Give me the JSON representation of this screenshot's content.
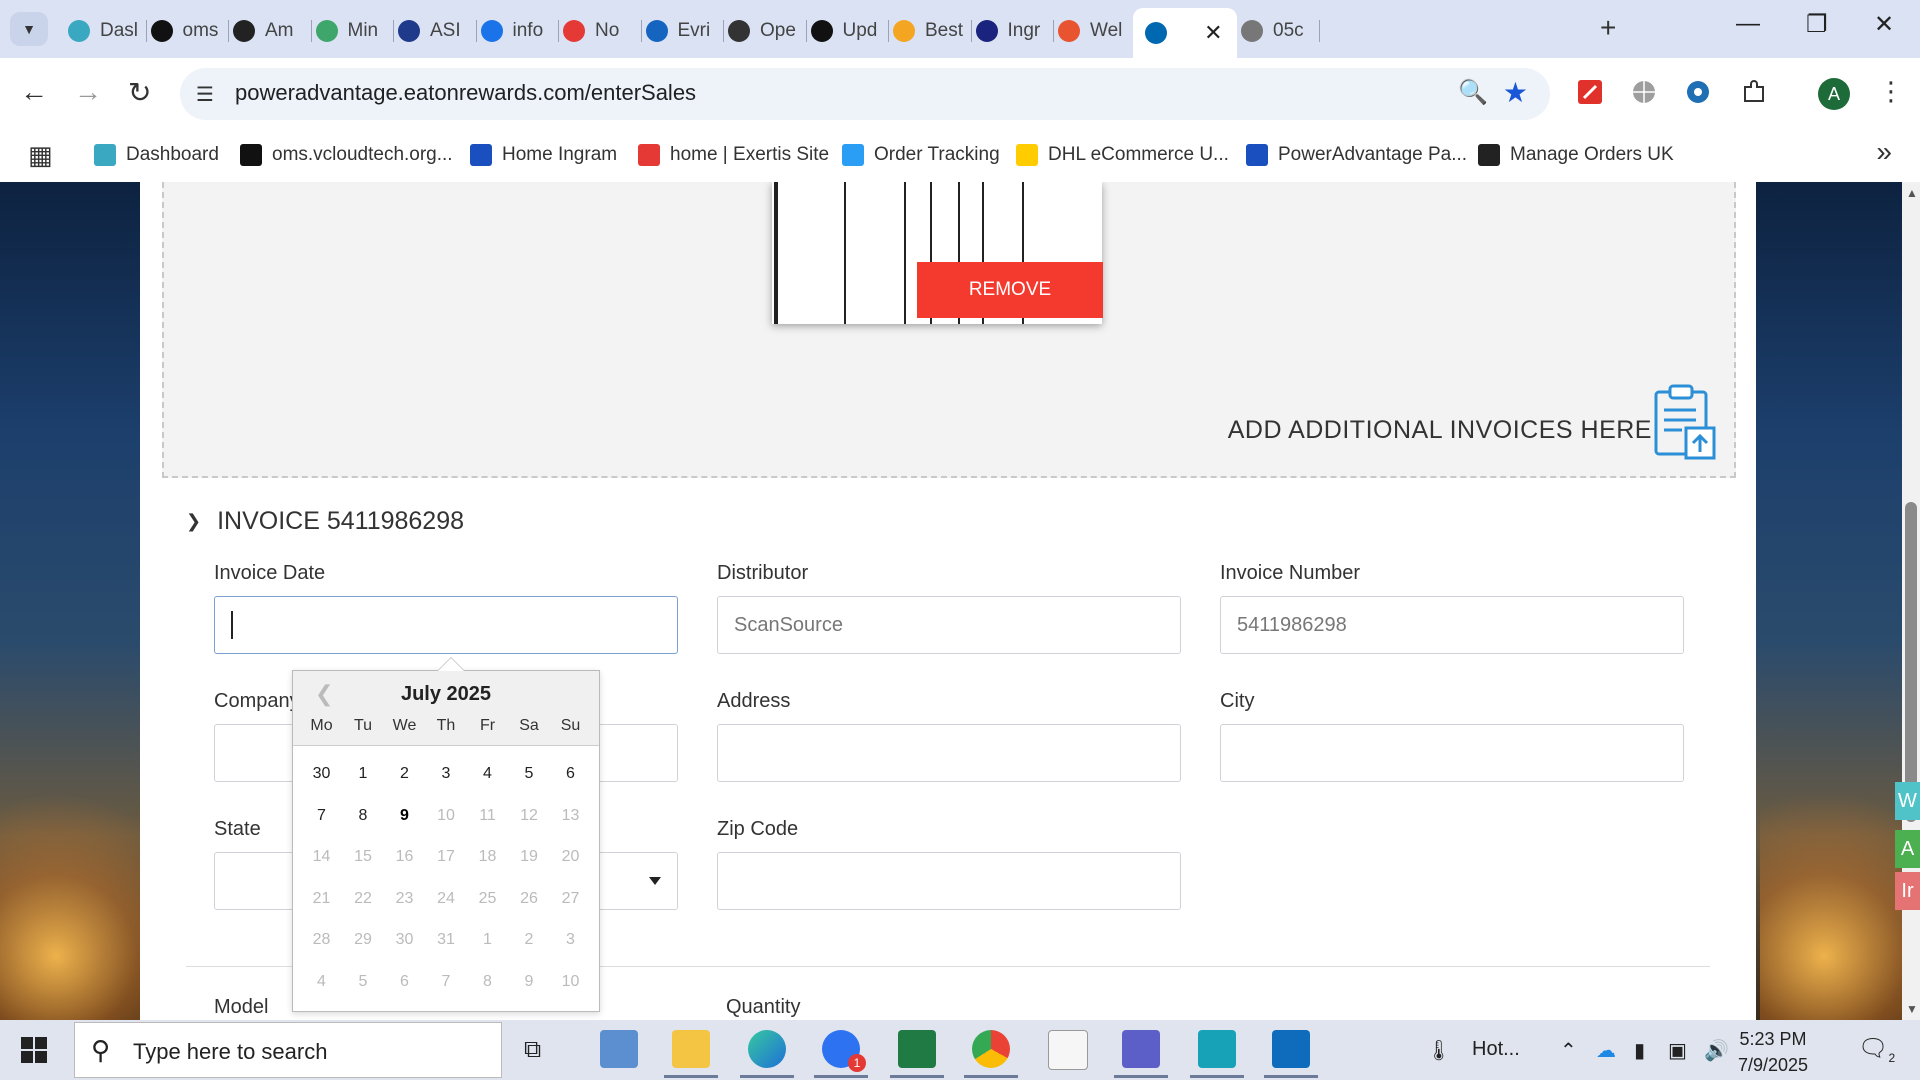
{
  "browser": {
    "tabs": [
      {
        "label": "Dasl",
        "icon": "hex-blue-icon",
        "color": "#3aa8c1"
      },
      {
        "label": "oms",
        "icon": "triangle-black-icon",
        "color": "#111111"
      },
      {
        "label": "Am",
        "icon": "amazon-icon",
        "color": "#222222"
      },
      {
        "label": "Min",
        "icon": "leaf-icon",
        "color": "#3fa66b"
      },
      {
        "label": "ASI",
        "icon": "play-arrow-icon",
        "color": "#1f3a8a"
      },
      {
        "label": "info",
        "icon": "swirl-icon",
        "color": "#1a73e8"
      },
      {
        "label": "No",
        "icon": "exertis-icon",
        "color": "#e53935"
      },
      {
        "label": "Evri",
        "icon": "evri-icon",
        "color": "#1565c0"
      },
      {
        "label": "Ope",
        "icon": "openai-icon",
        "color": "#333333"
      },
      {
        "label": "Upd",
        "icon": "openai-icon",
        "color": "#111111"
      },
      {
        "label": "Best",
        "icon": "bulb-icon",
        "color": "#f4a623"
      },
      {
        "label": "Ingr",
        "icon": "ingram-icon",
        "color": "#1a237e"
      },
      {
        "label": "Wel",
        "icon": "cube-icon",
        "color": "#e8542f"
      },
      {
        "label": "",
        "icon": "eaton-icon",
        "color": "#0067b1",
        "active": true
      },
      {
        "label": "05c",
        "icon": "globe-icon",
        "color": "#777777"
      }
    ],
    "url": "poweradvantage.eatonrewards.com/enterSales",
    "profile_initial": "A",
    "bookmarks": [
      {
        "label": "Dashboard",
        "icon": "hex-blue-icon",
        "color": "#3aa8c1"
      },
      {
        "label": "oms.vcloudtech.org...",
        "icon": "triangle-black-icon",
        "color": "#111111"
      },
      {
        "label": "Home Ingram",
        "icon": "im-icon",
        "color": "#1a4fc0"
      },
      {
        "label": "home | Exertis Site",
        "icon": "exertis-icon",
        "color": "#e53935"
      },
      {
        "label": "Order Tracking",
        "icon": "c-circle-icon",
        "color": "#2a9df4"
      },
      {
        "label": "DHL eCommerce U...",
        "icon": "dhl-icon",
        "color": "#ffcc00"
      },
      {
        "label": "PowerAdvantage Pa...",
        "icon": "document-blue-icon",
        "color": "#1a4fc0"
      },
      {
        "label": "Manage Orders UK",
        "icon": "amazon-icon",
        "color": "#222222"
      }
    ]
  },
  "page": {
    "remove_label": "REMOVE",
    "add_invoices_label": "ADD ADDITIONAL INVOICES HERE",
    "invoice_title": "INVOICE 5411986298",
    "fields": {
      "invoice_date_label": "Invoice Date",
      "invoice_date_value": "",
      "distributor_label": "Distributor",
      "distributor_value": "ScanSource",
      "invoice_number_label": "Invoice Number",
      "invoice_number_value": "5411986298",
      "company_label": "Company",
      "address_label": "Address",
      "city_label": "City",
      "state_label": "State",
      "zip_label": "Zip Code",
      "model_label": "Model",
      "quantity_label": "Quantity"
    },
    "calendar": {
      "title": "July 2025",
      "weekdays": [
        "Mo",
        "Tu",
        "We",
        "Th",
        "Fr",
        "Sa",
        "Su"
      ],
      "weeks": [
        [
          "30",
          "1",
          "2",
          "3",
          "4",
          "5",
          "6"
        ],
        [
          "7",
          "8",
          "9",
          "10",
          "11",
          "12",
          "13"
        ],
        [
          "14",
          "15",
          "16",
          "17",
          "18",
          "19",
          "20"
        ],
        [
          "21",
          "22",
          "23",
          "24",
          "25",
          "26",
          "27"
        ],
        [
          "28",
          "29",
          "30",
          "31",
          "1",
          "2",
          "3"
        ],
        [
          "4",
          "5",
          "6",
          "7",
          "8",
          "9",
          "10"
        ]
      ],
      "today": "9",
      "enabled_through": "9"
    },
    "side_tabs": [
      "W",
      "A",
      "Ir"
    ],
    "side_tab_colors": [
      "#4fc3c7",
      "#4caf50",
      "#e57373"
    ]
  },
  "taskbar": {
    "search_placeholder": "Type here to search",
    "weather_label": "Hot...",
    "time": "5:23 PM",
    "date": "7/9/2025",
    "notification_count": "2",
    "zoom_badge": "1"
  }
}
